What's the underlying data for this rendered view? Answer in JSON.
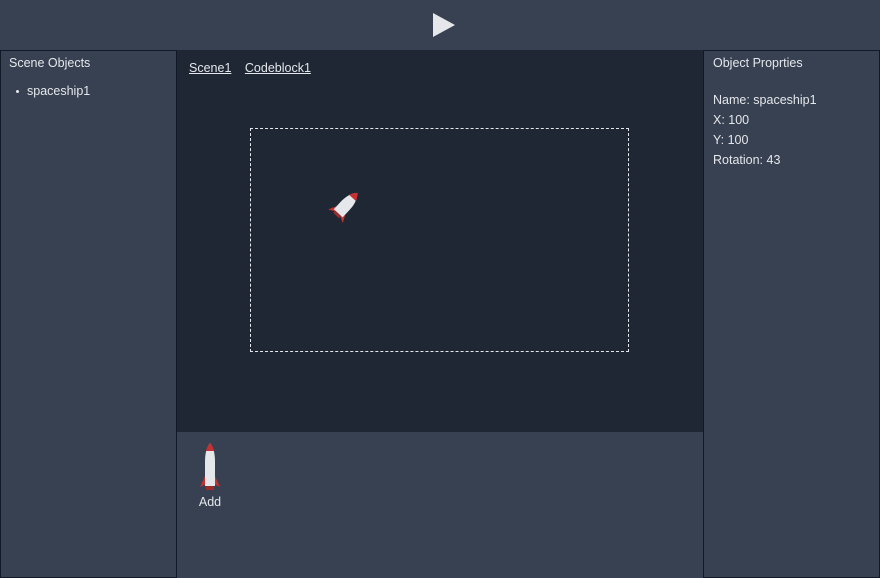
{
  "toolbar": {
    "play_icon": "play-icon"
  },
  "scene_objects": {
    "title": "Scene Objects",
    "items": [
      "spaceship1"
    ]
  },
  "tabs": [
    "Scene1",
    "Codeblock1"
  ],
  "canvas": {
    "sprite_icon": "rocket-icon",
    "sprite_rotation_deg": 43
  },
  "properties": {
    "title": "Object Proprties",
    "name": "Name: spaceship1",
    "x": "X: 100",
    "y": "Y: 100",
    "rotation": "Rotation: 43"
  },
  "assets": {
    "items": [
      {
        "label": "Add",
        "icon": "rocket-icon"
      }
    ]
  },
  "colors": {
    "panel_bg": "#374151",
    "canvas_bg": "#1f2735",
    "rocket_body": "#e5e7eb",
    "rocket_accent": "#c53030",
    "text": "#e5e7eb"
  }
}
